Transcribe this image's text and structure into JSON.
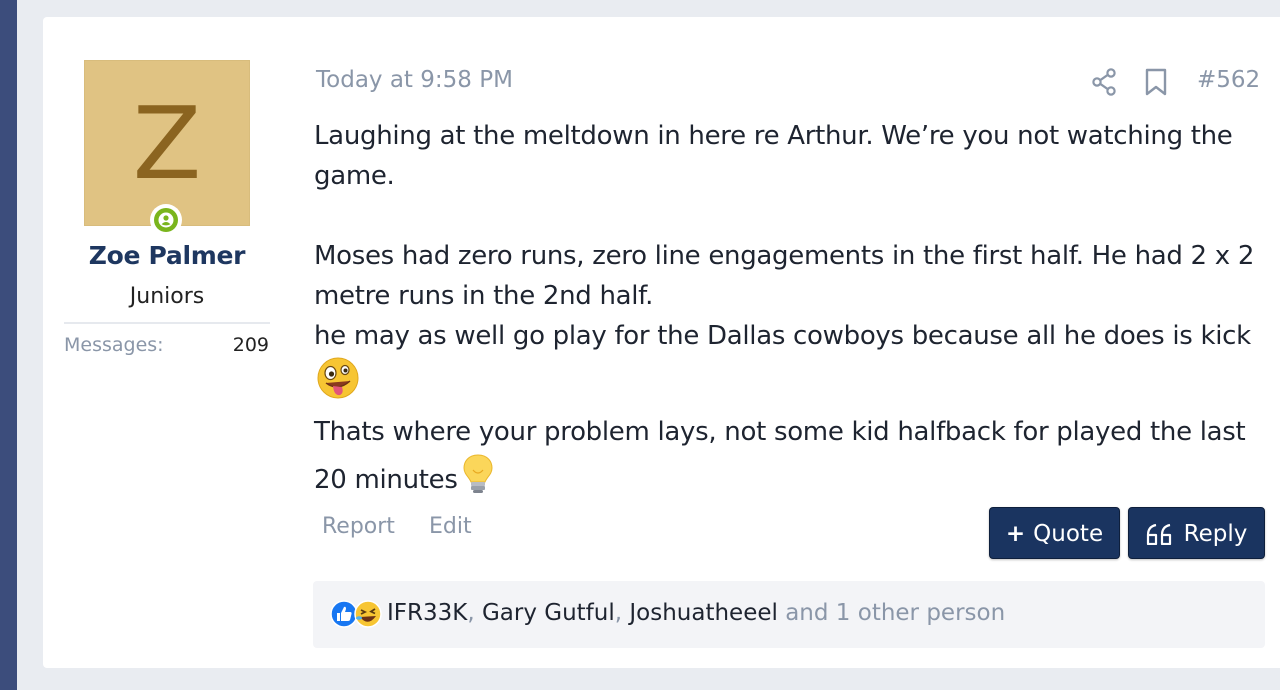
{
  "user": {
    "avatar_letter": "Z",
    "avatar_color": "#e0c383",
    "online_status": "online",
    "name": "Zoe Palmer",
    "title": "Juniors",
    "messages_label": "Messages:",
    "messages_count": "209"
  },
  "post": {
    "date": "Today at 9:58 PM",
    "number": "#562",
    "paragraph1": "Laughing at the meltdown in here re Arthur. We’re you not watching the game.",
    "line2": "Moses had zero runs, zero line engagements in the first half. He had 2 x 2 metre runs in the 2nd half.",
    "line3": "he may as well go play for the Dallas cowboys because all he does is kick",
    "line3_emoji": "zany-face-emoji",
    "line4": "Thats where your problem lays, not some kid halfback for played the last 20 minutes",
    "line4_emoji": "light-bulb-emoji"
  },
  "actions": {
    "report": "Report",
    "edit": "Edit",
    "quote": "Quote",
    "quote_glyph": "+",
    "reply": "Reply"
  },
  "reactions": {
    "icons": [
      "like-icon",
      "laugh-icon"
    ],
    "names": [
      "IFR33K",
      "Gary Gutful",
      "Joshuatheeel"
    ],
    "separator": ", ",
    "suffix": " and 1 other person"
  },
  "colors": {
    "accent": "#1a3460",
    "muted": "#8a96a8",
    "online": "#7ab51d",
    "sidebar_strip": "#3c4d7c"
  }
}
